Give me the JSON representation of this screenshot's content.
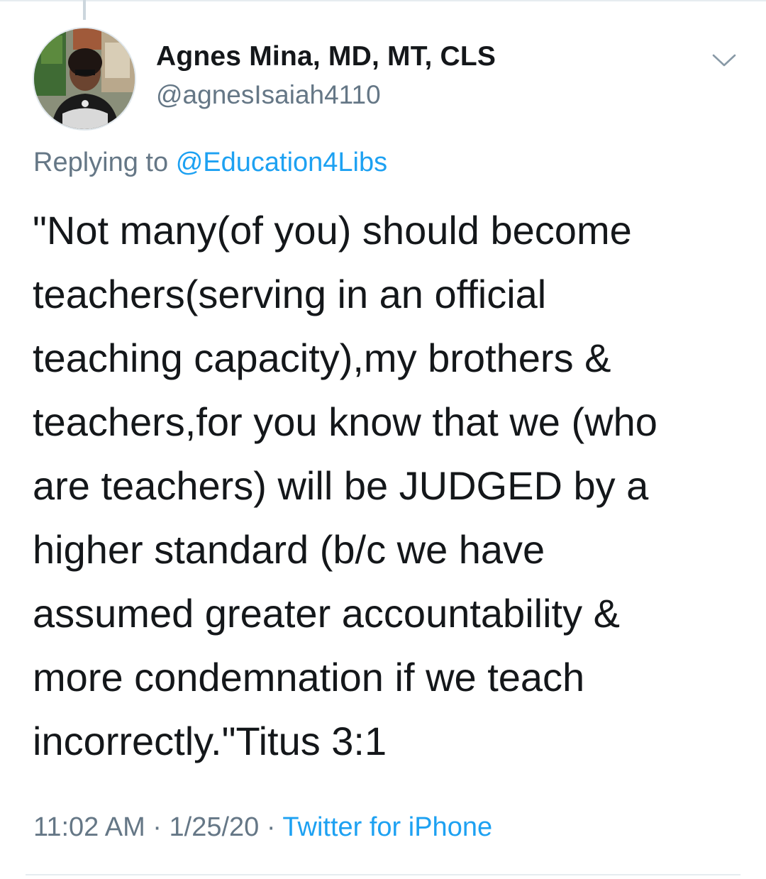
{
  "tweet": {
    "author": {
      "display_name": "Agnes Mina, MD, MT, CLS",
      "handle": "@agnesIsaiah4110"
    },
    "reply_context": {
      "prefix": "Replying to",
      "mention": "@Education4Libs"
    },
    "text": "\"Not many(of you) should become\nteachers(serving in an official\nteaching capacity),my brothers &\nteachers,for you know that we (who\nare teachers) will be JUDGED by a\nhigher standard (b/c we have\nassumed greater accountability &\nmore condemnation if we teach\nincorrectly.\"Titus 3:1",
    "time": "11:02 AM",
    "date": "1/25/20",
    "separator": "·",
    "source": "Twitter for iPhone"
  },
  "icons": {
    "menu": "chevron-down-icon",
    "avatar": "profile-photo"
  },
  "colors": {
    "link": "#1da1f2",
    "secondary_text": "#657786",
    "primary_text": "#14171a",
    "border": "#e6ecf0"
  }
}
